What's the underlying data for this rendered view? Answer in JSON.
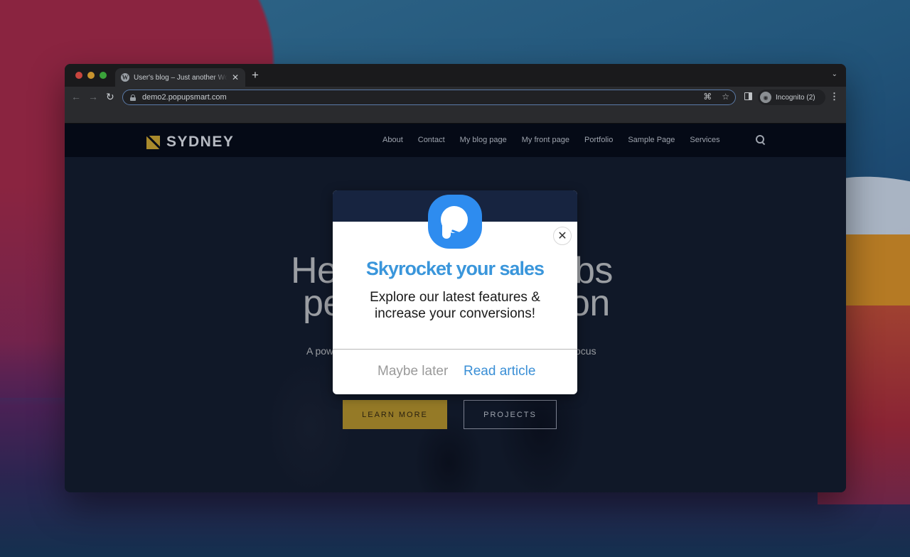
{
  "browser": {
    "tab": {
      "favicon": "wordpress-icon",
      "title": "User's blog – Just another WordPress site",
      "close_glyph": "✕"
    },
    "new_tab_glyph": "+",
    "tab_dropdown_glyph": "⌄",
    "nav": {
      "back_glyph": "←",
      "forward_glyph": "→",
      "reload_glyph": "↻"
    },
    "url": "demo2.popupsmart.com",
    "omnibox_icons": {
      "qr_glyph": "⌘",
      "star_glyph": "☆"
    },
    "profile": {
      "label": "Incognito (2)",
      "avatar_glyph": "◉"
    },
    "menu_glyph": "⋮"
  },
  "site": {
    "logo_text": "SYDNEY",
    "logo_color": "#a98a2c",
    "nav": [
      {
        "label": "About"
      },
      {
        "label": "Contact"
      },
      {
        "label": "My blog page"
      },
      {
        "label": "My front page"
      },
      {
        "label": "Portfolio"
      },
      {
        "label": "Sample Page"
      },
      {
        "label": "Services"
      }
    ],
    "hero": {
      "line1_left": "He",
      "line1_right": "bs",
      "line2_left": "pe",
      "line2_right": "on",
      "sub_left": "A pow",
      "sub_right": "ocus",
      "learn_more": "LEARN MORE",
      "projects": "PROJECTS"
    }
  },
  "popup": {
    "title": "Skyrocket your sales",
    "body": "Explore our latest features & increase your conversions!",
    "close_glyph": "✕",
    "secondary_button": "Maybe later",
    "primary_button": "Read article",
    "accent_color": "#3a96db",
    "logo_color": "#2e8cef"
  }
}
